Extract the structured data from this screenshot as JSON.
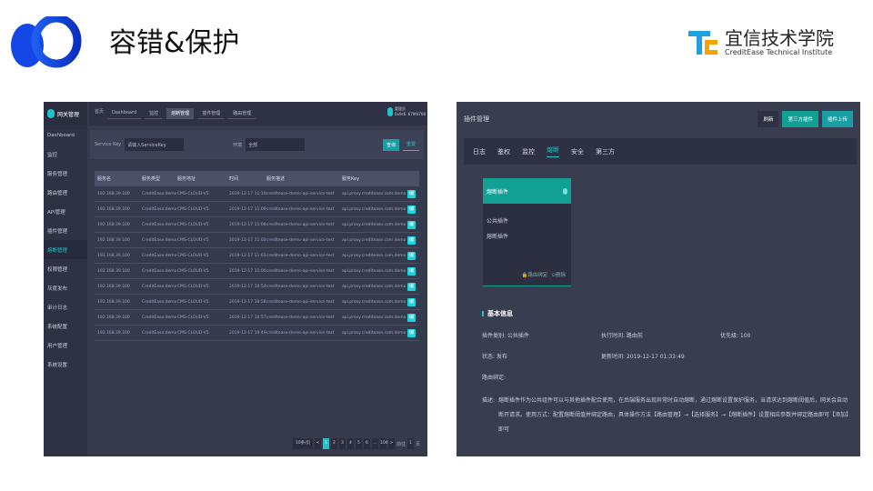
{
  "slide": {
    "title": "容错&保护",
    "brand_cn": "宜信技术学院",
    "brand_en": "CreditEase Technical Institute"
  },
  "left": {
    "app_name": "网关管理",
    "sidebar": [
      "Dashboard",
      "监控",
      "服务管理",
      "路由管理",
      "API管理",
      "插件管理",
      "熔断管理",
      "权限管理",
      "灰度发布",
      "审计日志",
      "系统配置",
      "用户管理",
      "系统设置"
    ],
    "active_index": 6,
    "crumbs": [
      "首页",
      "Dashboard",
      "监控",
      "熔断管理",
      "插件管理",
      "路由管理"
    ],
    "user": {
      "name": "管理员",
      "id": "0x9c6..679fd708"
    },
    "filter": {
      "label1": "Service Key",
      "value1": "请输入ServiceKey",
      "label2": "环境",
      "value2": "全部",
      "search": "查询",
      "reset": "重置"
    },
    "columns": [
      "服务名",
      "服务类型",
      "服务地址",
      "时间",
      "服务描述",
      "服务Key"
    ],
    "rows": [
      [
        "192.168.39.100",
        "CreditEase.demo",
        "CMS-CLOUD-V5",
        "2019-12-17 11:10",
        "creditease-demo-api-service-test",
        "api.proxy.creditease.com.demo"
      ],
      [
        "192.168.39.100",
        "CreditEase.demo",
        "CMS-CLOUD-V5",
        "2019-12-17 11:09",
        "creditease-demo-api-service-test",
        "api.proxy.creditease.com.demo"
      ],
      [
        "192.168.39.100",
        "CreditEase.demo",
        "CMS-CLOUD-V5",
        "2019-12-17 11:08",
        "creditease-demo-api-service-test",
        "api.proxy.creditease.com.demo"
      ],
      [
        "192.168.39.100",
        "CreditEase.demo",
        "CMS-CLOUD-V5",
        "2019-12-17 11:02",
        "creditease-demo-api-service-test",
        "api.proxy.creditease.com.demo"
      ],
      [
        "192.168.39.100",
        "CreditEase.demo",
        "CMS-CLOUD-V5",
        "2019-12-17 11:01",
        "creditease-demo-api-service-test",
        "api.proxy.creditease.com.demo"
      ],
      [
        "192.168.39.100",
        "CreditEase.demo",
        "CMS-CLOUD-V5",
        "2019-12-17 11:00",
        "creditease-demo-api-service-test",
        "api.proxy.creditease.com.demo"
      ],
      [
        "192.168.39.100",
        "CreditEase.demo",
        "CMS-CLOUD-V5",
        "2019-12-17 10:54",
        "creditease-demo-api-service-test",
        "api.proxy.creditease.com.demo"
      ],
      [
        "192.168.39.100",
        "CreditEase.demo",
        "CMS-CLOUD-V5",
        "2019-12-17 10:58",
        "creditease-demo-api-service-test",
        "api.proxy.creditease.com.demo"
      ],
      [
        "192.168.39.100",
        "CreditEase.demo",
        "CMS-CLOUD-V5",
        "2019-12-17 10:57",
        "creditease-demo-api-service-test",
        "api.proxy.creditease.com.demo"
      ],
      [
        "192.168.39.100",
        "CreditEase.demo",
        "CMS-CLOUD-V5",
        "2019-12-17 10:49",
        "creditease-demo-api-service-test",
        "api.proxy.creditease.com.demo"
      ]
    ],
    "row_action": "编",
    "pagination": {
      "size": "10条/页",
      "pages": [
        "<",
        "1",
        "2",
        "3",
        "4",
        "5",
        "6",
        "...",
        "100",
        ">"
      ],
      "current": "1",
      "goto_label": "前往",
      "goto_value": "1",
      "goto_unit": "页"
    }
  },
  "right": {
    "title": "插件管理",
    "buttons": [
      "刷新",
      "第三方插件",
      "插件上传"
    ],
    "tabs": [
      "日志",
      "鉴权",
      "监控",
      "熔断",
      "安全",
      "第三方"
    ],
    "active_tab": 3,
    "card": {
      "title": "熔断插件",
      "items": [
        "公共插件",
        "熔断插件"
      ],
      "bind": "路由绑定",
      "delete": "删除"
    },
    "info": {
      "heading": "基本信息",
      "type": "插件类别: 公共插件",
      "exec": "执行时间: 路由前",
      "priority": "优先级: 100",
      "status": "状态: 发布",
      "updated": "更新时间: 2019-12-17 01:33:49",
      "route": "路由绑定:",
      "desc_label": "描述:",
      "desc": "熔断插件作为公共组件可以与其他插件配合使用，在后端服务出现异常时自动熔断，通过熔断设置保护服务，当请求达到熔断阈值后，网关会自动断开请求。使用方式：配置熔断阈值并绑定路由，具体操作方法【路由管理】→【选择服务】→【熔断插件】设置相应参数并绑定路由即可【添加】即可"
    }
  }
}
